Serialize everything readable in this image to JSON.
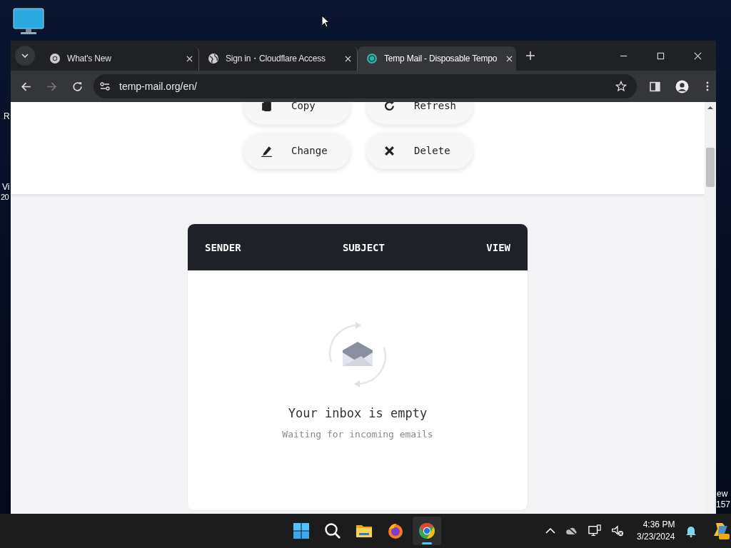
{
  "desktop": {
    "left_fragments": [
      "R",
      "Vi",
      "20"
    ],
    "right_fragments": [
      "ew",
      "157"
    ]
  },
  "browser": {
    "tabs": [
      {
        "title": "What's New",
        "selected": false
      },
      {
        "title": "Sign in・Cloudflare Access",
        "selected": false
      },
      {
        "title": "Temp Mail - Disposable Tempo",
        "selected": true
      }
    ],
    "address": "temp-mail.org/en/"
  },
  "page": {
    "actions": [
      {
        "label": "Copy"
      },
      {
        "label": "Refresh"
      },
      {
        "label": "Change"
      },
      {
        "label": "Delete"
      }
    ],
    "table": {
      "columns": [
        "SENDER",
        "SUBJECT",
        "VIEW"
      ]
    },
    "empty_state": {
      "title": "Your inbox is empty",
      "subtitle": "Waiting for incoming emails"
    }
  },
  "taskbar": {
    "apps": [
      {
        "kind": "start",
        "selected": false
      },
      {
        "kind": "search",
        "selected": false
      },
      {
        "kind": "files",
        "selected": false
      },
      {
        "kind": "firefox",
        "selected": false
      },
      {
        "kind": "chrome",
        "selected": true
      }
    ],
    "clock": {
      "time": "4:36 PM",
      "date": "3/23/2024"
    }
  }
}
